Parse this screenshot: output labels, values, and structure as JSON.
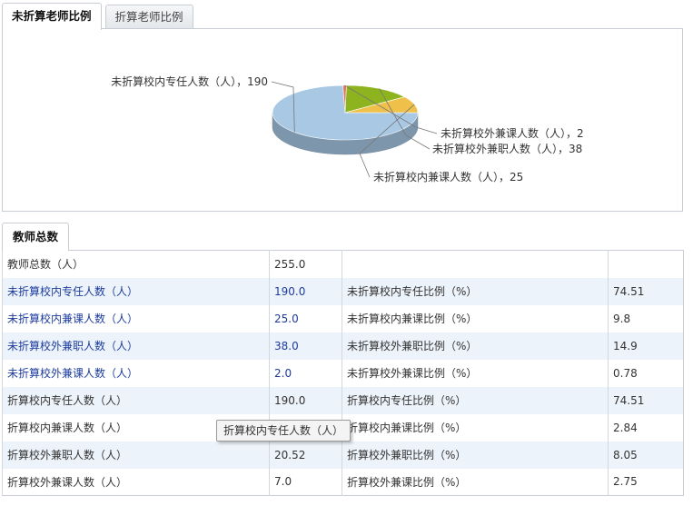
{
  "tabs": [
    {
      "label": "未折算老师比例",
      "active": true
    },
    {
      "label": "折算老师比例",
      "active": false
    }
  ],
  "chart_data": {
    "type": "pie",
    "labels": [
      "未折算校内专任人数（人）",
      "未折算校外兼课人数（人）",
      "未折算校外兼职人数（人）",
      "未折算校内兼课人数（人）"
    ],
    "values": [
      190,
      2,
      38,
      25
    ],
    "slice_labels": [
      "未折算校内专任人数（人），190",
      "未折算校外兼课人数（人），2",
      "未折算校外兼职人数（人），38",
      "未折算校内兼课人数（人），25"
    ],
    "colors": [
      "#a8c8e4",
      "#e0735a",
      "#8db31e",
      "#f0c14a"
    ],
    "style": "3d"
  },
  "section": {
    "tab_label": "教师总数"
  },
  "table": {
    "rows": [
      {
        "c1": "教师总数（人）",
        "c2": "255.0",
        "c3": "",
        "c4": "",
        "link": false,
        "shade": false
      },
      {
        "c1": "未折算校内专任人数（人）",
        "c2": "190.0",
        "c3": "未折算校内专任比例（%）",
        "c4": "74.51",
        "link": true,
        "shade": true
      },
      {
        "c1": "未折算校内兼课人数（人）",
        "c2": "25.0",
        "c3": "未折算校内兼课比例（%）",
        "c4": "9.8",
        "link": true,
        "shade": false
      },
      {
        "c1": "未折算校外兼职人数（人）",
        "c2": "38.0",
        "c3": "未折算校外兼职比例（%）",
        "c4": "14.9",
        "link": true,
        "shade": true
      },
      {
        "c1": "未折算校外兼课人数（人）",
        "c2": "2.0",
        "c3": "未折算校外兼课比例（%）",
        "c4": "0.78",
        "link": true,
        "shade": false
      },
      {
        "c1": "折算校内专任人数（人）",
        "c2": "190.0",
        "c3": "折算校内专任比例（%）",
        "c4": "74.51",
        "link": false,
        "shade": true
      },
      {
        "c1": "折算校内兼课人数（人）",
        "c2": "",
        "c3": "折算校内兼课比例（%）",
        "c4": "2.84",
        "link": false,
        "shade": false
      },
      {
        "c1": "折算校外兼职人数（人）",
        "c2": "20.52",
        "c3": "折算校外兼职比例（%）",
        "c4": "8.05",
        "link": false,
        "shade": true
      },
      {
        "c1": "折算校外兼课人数（人）",
        "c2": "7.0",
        "c3": "折算校外兼课比例（%）",
        "c4": "2.75",
        "link": false,
        "shade": false
      }
    ]
  },
  "tooltip": {
    "text": "折算校内专任人数（人）"
  }
}
